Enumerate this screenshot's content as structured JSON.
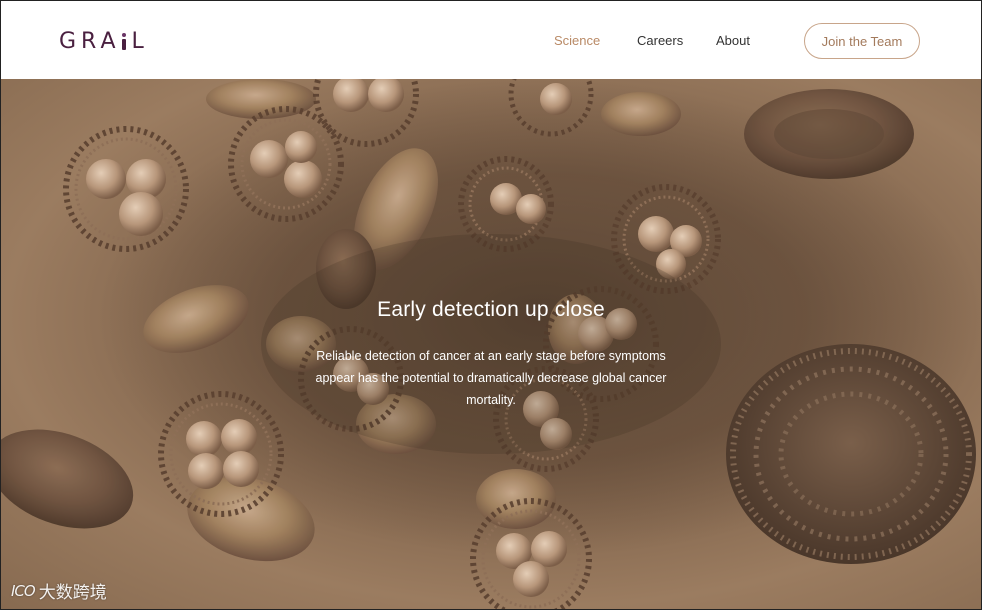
{
  "header": {
    "logo_text": "GRAIL",
    "nav": [
      "Science",
      "Careers",
      "About"
    ],
    "cta_label": "Join the Team"
  },
  "hero": {
    "title": "Early detection up close",
    "subtitle": "Reliable detection of cancer at an early stage before symptoms appear has the potential to dramatically decrease global cancer mortality."
  },
  "watermark": {
    "mark": "ICO",
    "text": "大数跨境"
  },
  "colors": {
    "brand": "#4a2040",
    "accent": "#b98a66",
    "hero_tint": "#8a6c52"
  }
}
